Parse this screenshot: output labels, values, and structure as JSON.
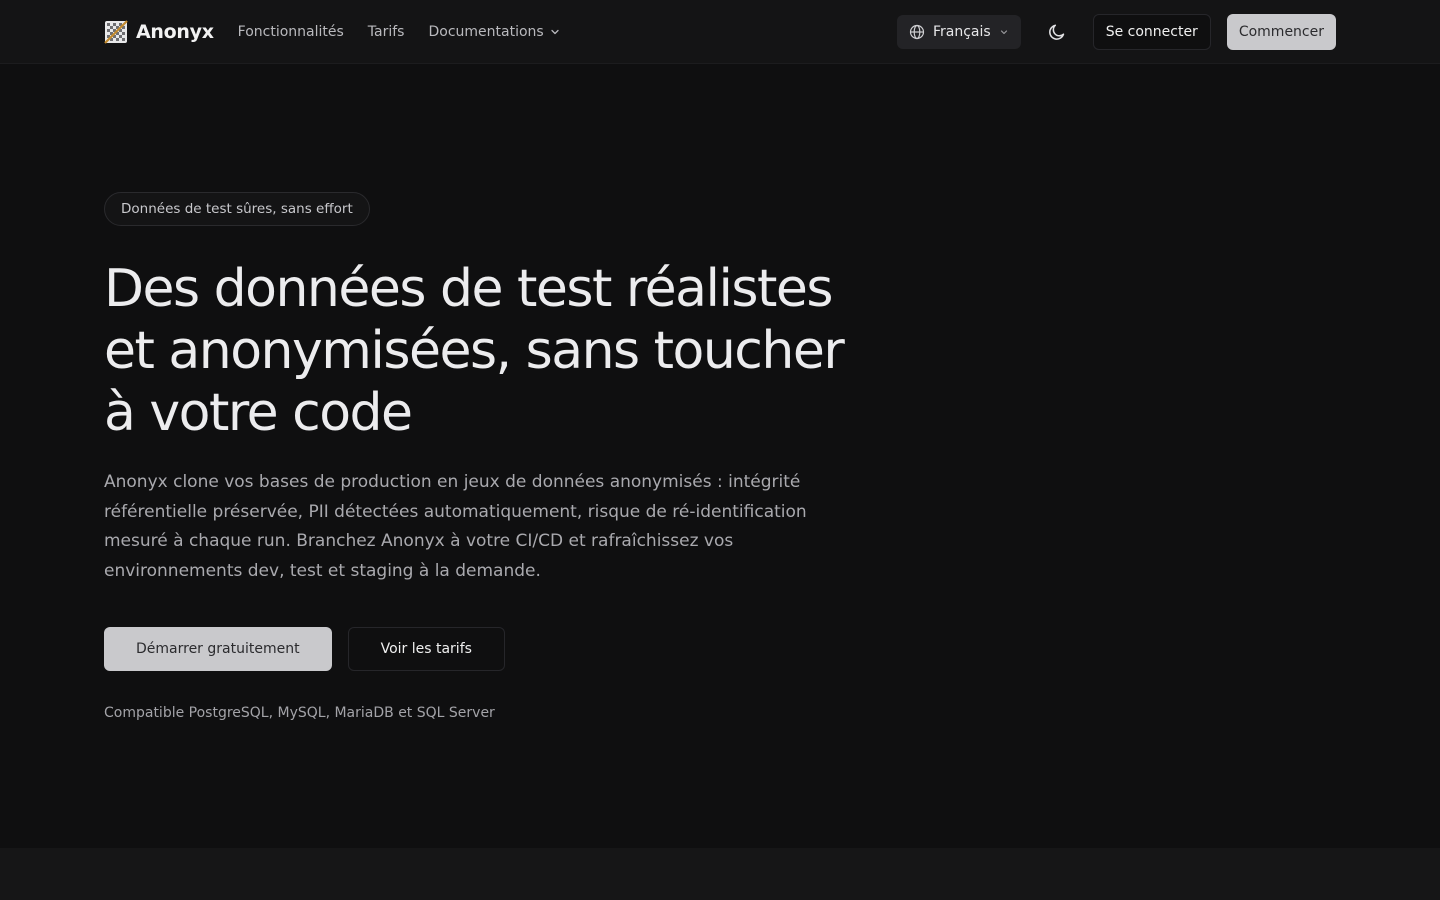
{
  "brand": {
    "name": "Anonyx",
    "logo_icon": "checkered-logo-icon"
  },
  "nav": {
    "features": "Fonctionnalités",
    "pricing": "Tarifs",
    "docs": "Documentations"
  },
  "header": {
    "language": "Français",
    "theme_icon": "moon-icon",
    "login": "Se connecter",
    "get_started": "Commencer"
  },
  "hero": {
    "badge": "Données de test sûres, sans effort",
    "title": "Des données de test réalistes et anonymisées, sans toucher à votre code",
    "description": "Anonyx clone vos bases de production en jeux de données anonymisés : intégrité référentielle préservée, PII détectées automatiquement, risque de ré-identification mesuré à chaque run. Branchez Anonyx à votre CI/CD et rafraîchissez vos environnements dev, test et staging à la demande.",
    "cta_primary": "Démarrer gratuitement",
    "cta_secondary": "Voir les tarifs",
    "compatibility": "Compatible PostgreSQL, MySQL, MariaDB et SQL Server"
  },
  "colors": {
    "background": "#0f0f10",
    "header_bg": "#141415",
    "primary_button": "#c9c9cc",
    "text": "#ececee",
    "muted_text": "#a9a9ae"
  }
}
